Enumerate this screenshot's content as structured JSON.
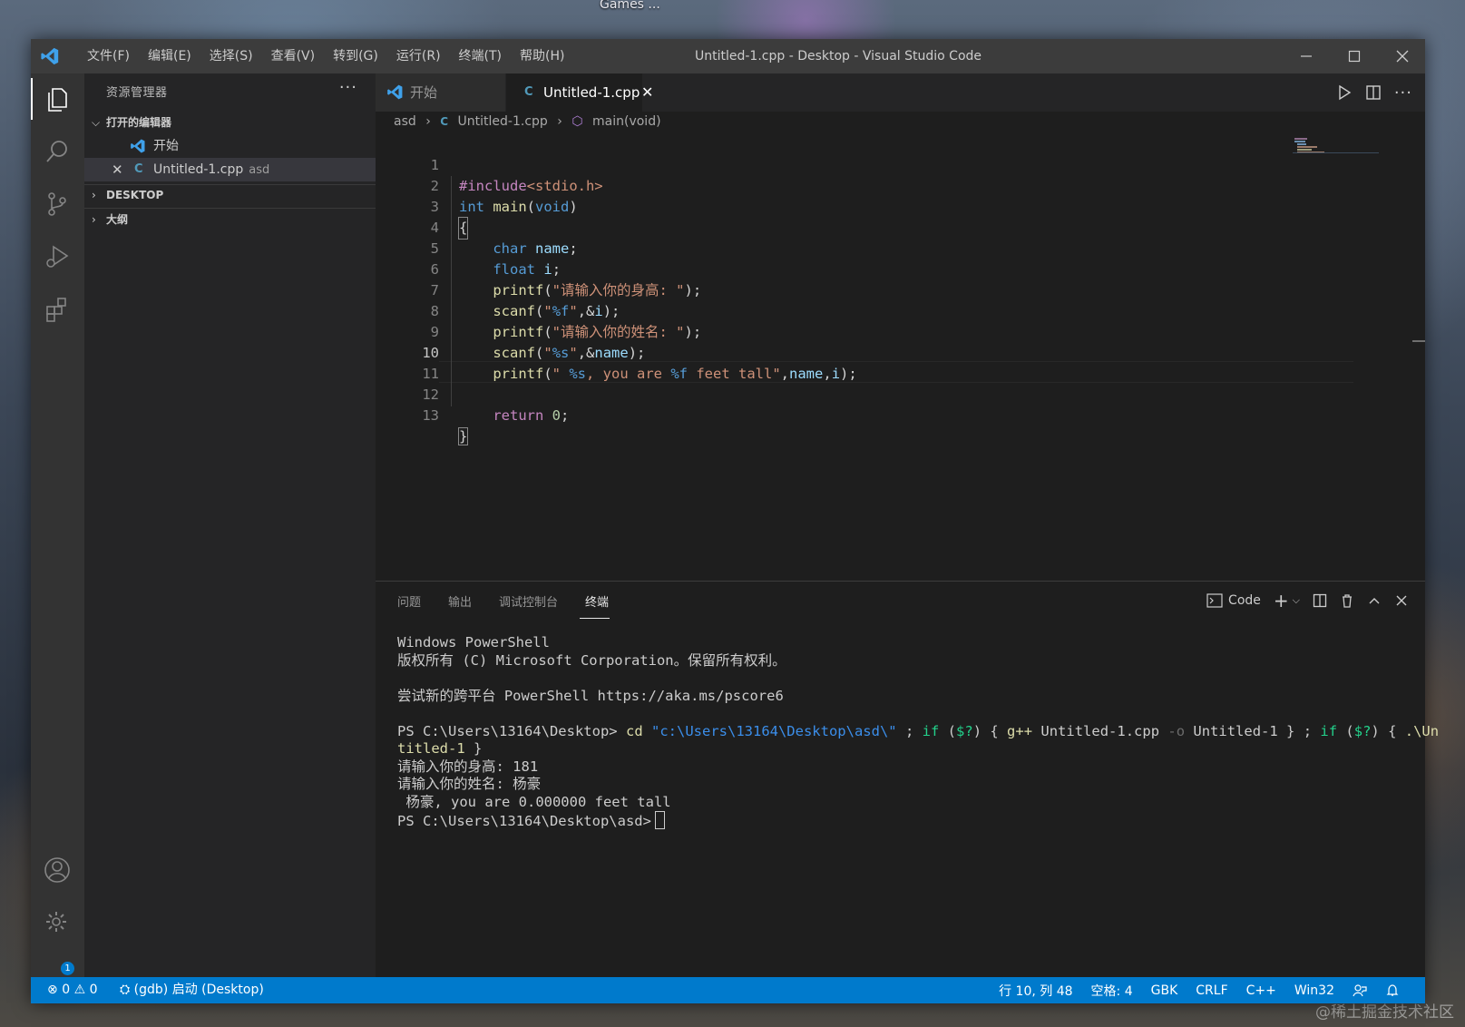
{
  "desktop": {
    "label": "Games ...",
    "watermark": "@稀土掘金技术社区"
  },
  "titlebar": {
    "menu": [
      "文件(F)",
      "编辑(E)",
      "选择(S)",
      "查看(V)",
      "转到(G)",
      "运行(R)",
      "终端(T)",
      "帮助(H)"
    ],
    "title": "Untitled-1.cpp - Desktop - Visual Studio Code"
  },
  "activity_bar": {
    "icons": [
      "explorer-icon",
      "search-icon",
      "source-control-icon",
      "run-debug-icon",
      "extensions-icon",
      "account-icon",
      "settings-gear-icon"
    ],
    "settings_badge": "1"
  },
  "sidebar": {
    "title": "资源管理器",
    "open_editors": {
      "header": "打开的编辑器",
      "items": [
        {
          "label": "开始",
          "description": ""
        },
        {
          "label": "Untitled-1.cpp",
          "description": "asd"
        }
      ]
    },
    "sections": [
      "DESKTOP",
      "大纲"
    ]
  },
  "tabs": [
    {
      "label": "开始",
      "active": false
    },
    {
      "label": "Untitled-1.cpp",
      "active": true
    }
  ],
  "breadcrumb": [
    "asd",
    "Untitled-1.cpp",
    "main(void)"
  ],
  "editor": {
    "current_line": 10,
    "line_numbers": [
      "1",
      "2",
      "3",
      "4",
      "5",
      "6",
      "7",
      "8",
      "9",
      "10",
      "11",
      "12",
      "13"
    ],
    "lines": [
      "#include<stdio.h>",
      "int main(void)",
      "{",
      "    char name;",
      "    float i;",
      "    printf(\"请输入你的身高: \");",
      "    scanf(\"%f\",&i);",
      "    printf(\"请输入你的姓名: \");",
      "    scanf(\"%s\",&name);",
      "    printf(\" %s, you are %f feet tall\",name,i);",
      "",
      "    return 0;",
      "}"
    ]
  },
  "panel": {
    "tabs": [
      "问题",
      "输出",
      "调试控制台",
      "终端"
    ],
    "active_tab": "终端",
    "terminal_profile": "Code",
    "terminal": {
      "l1": "Windows PowerShell",
      "l2": "版权所有 (C) Microsoft Corporation。保留所有权利。",
      "l3": "尝试新的跨平台 PowerShell https://aka.ms/pscore6",
      "prompt1": "PS C:\\Users\\13164\\Desktop>",
      "cmd_cd": "cd",
      "cmd_path": "\"c:\\Users\\13164\\Desktop\\asd\\\"",
      "cmd_semi1": ";",
      "cmd_if1": "if",
      "cmd_cond1_open": "(",
      "cmd_cond1_var": "$?",
      "cmd_cond1_close": ") {",
      "cmd_gpp": "g++",
      "cmd_src": "Untitled-1.cpp",
      "cmd_o": "-o",
      "cmd_out": "Untitled-1 } ;",
      "cmd_if2": "if",
      "cmd_cond2_open": "(",
      "cmd_cond2_var": "$?",
      "cmd_cond2_close": ") {",
      "cmd_run1": ".\\Un",
      "cmd_run2": "titled-1",
      "cmd_run_close": "}",
      "out1": "请输入你的身高: 181",
      "out2": "请输入你的姓名: 杨豪",
      "out3": " 杨豪, you are 0.000000 feet tall",
      "prompt2": "PS C:\\Users\\13164\\Desktop\\asd>"
    }
  },
  "status_bar": {
    "errors": "0",
    "warnings": "0",
    "debug": "(gdb) 启动 (Desktop)",
    "position": "行 10, 列 48",
    "spaces": "空格: 4",
    "encoding": "GBK",
    "eol": "CRLF",
    "language": "C++",
    "config": "Win32",
    "color": "#007acc"
  }
}
